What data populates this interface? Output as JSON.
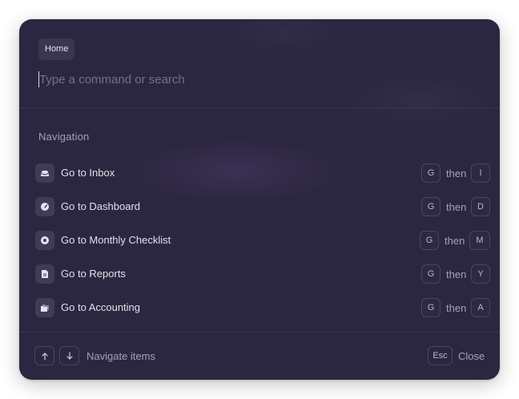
{
  "breadcrumb": {
    "label": "Home"
  },
  "search": {
    "placeholder": "Type a command or search",
    "value": ""
  },
  "section": {
    "title": "Navigation"
  },
  "items": [
    {
      "label": "Go to Inbox",
      "icon": "inbox-icon",
      "keys": [
        "G",
        "I"
      ],
      "joiner": "then"
    },
    {
      "label": "Go to Dashboard",
      "icon": "dashboard-gauge-icon",
      "keys": [
        "G",
        "D"
      ],
      "joiner": "then"
    },
    {
      "label": "Go to Monthly Checklist",
      "icon": "checklist-circle-icon",
      "keys": [
        "G",
        "M"
      ],
      "joiner": "then"
    },
    {
      "label": "Go to Reports",
      "icon": "document-icon",
      "keys": [
        "G",
        "Y"
      ],
      "joiner": "then"
    },
    {
      "label": "Go to Accounting",
      "icon": "folder-icon",
      "keys": [
        "G",
        "A"
      ],
      "joiner": "then"
    }
  ],
  "footer": {
    "navigate_label": "Navigate items",
    "esc_key": "Esc",
    "close_label": "Close"
  },
  "colors": {
    "panel_background": "#2c2740",
    "icon_tile": "#413c55",
    "key_border": "#4a4560",
    "text_primary": "#e2dfea",
    "text_secondary": "#a6a1b6"
  }
}
